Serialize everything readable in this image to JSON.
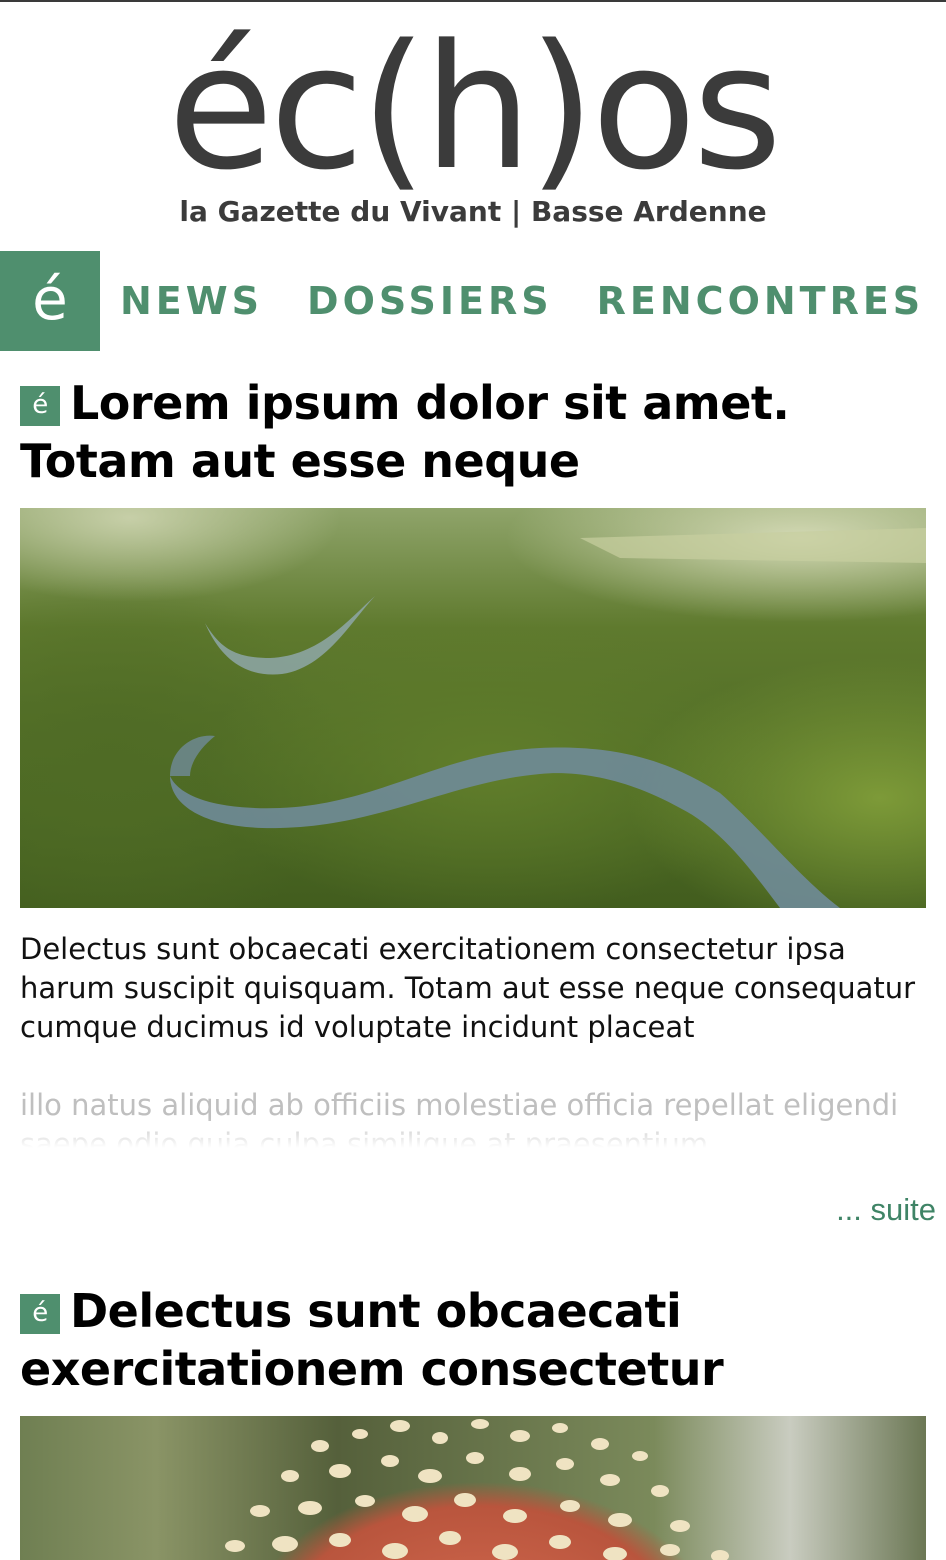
{
  "site": {
    "logo": "éc(h)os",
    "tagline": "la Gazette du Vivant | Basse Ardenne",
    "nav_badge": "é",
    "brand_color": "#4f8f6e"
  },
  "nav": {
    "items": [
      {
        "label": "NEWS"
      },
      {
        "label": "DOSSIERS"
      },
      {
        "label": "RENCONTRES"
      }
    ]
  },
  "articles": [
    {
      "badge": "é",
      "title": "Lorem ipsum dolor sit amet. Totam aut esse neque",
      "image_icon": "landscape-river-image",
      "body": "Delectus sunt obcaecati exercitationem consectetur ipsa harum suscipit quisquam. Totam aut esse neque consequatur cumque ducimus id voluptate incidunt placeat",
      "faded_body": "illo natus aliquid ab officiis molestiae officia repellat eligendi saepe odio quia culpa similique at praesentium",
      "more_link": "... suite"
    },
    {
      "badge": "é",
      "title": "Delectus sunt obcaecati exercitationem consectetur",
      "image_icon": "mushroom-image"
    }
  ]
}
